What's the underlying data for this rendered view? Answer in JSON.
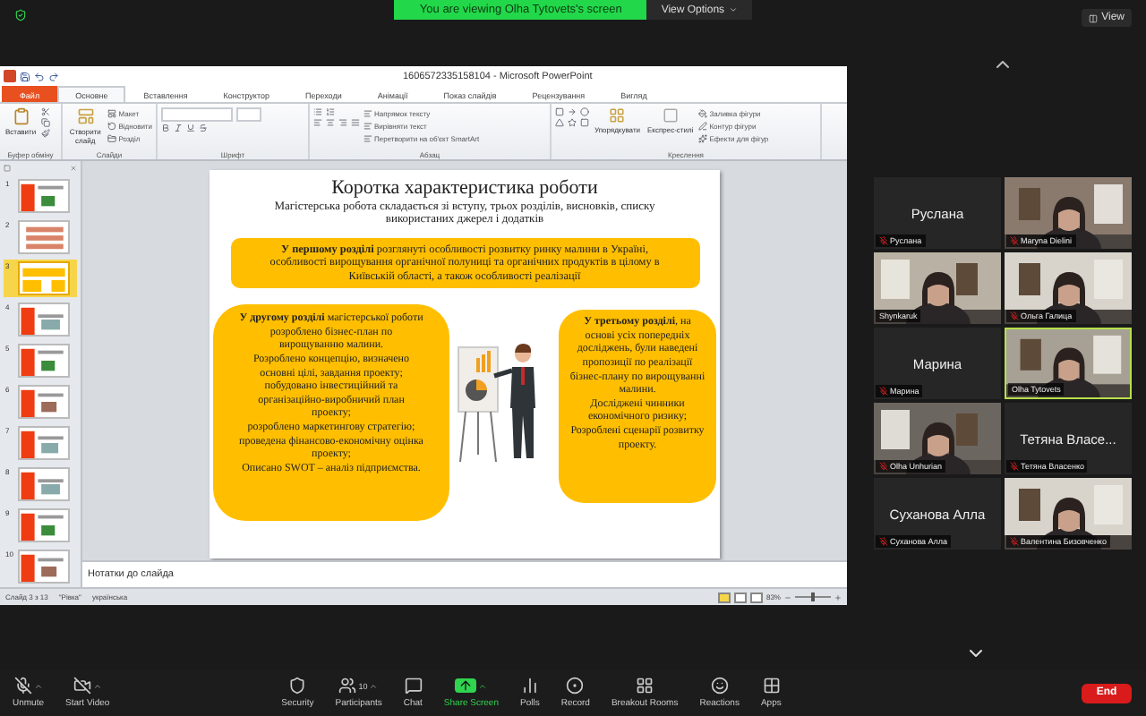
{
  "banner": {
    "text": "You are viewing Olha Tytovets's screen",
    "options": "View Options"
  },
  "view_button": "View",
  "powerpoint": {
    "title": "1606572335158104 - Microsoft PowerPoint",
    "tabs": [
      {
        "label": "Файл",
        "kind": "file",
        "selected": false
      },
      {
        "label": "Основне",
        "kind": "tab",
        "selected": true
      },
      {
        "label": "Вставлення",
        "kind": "tab",
        "selected": false
      },
      {
        "label": "Конструктор",
        "kind": "tab",
        "selected": false
      },
      {
        "label": "Переходи",
        "kind": "tab",
        "selected": false
      },
      {
        "label": "Анімації",
        "kind": "tab",
        "selected": false
      },
      {
        "label": "Показ слайдів",
        "kind": "tab",
        "selected": false
      },
      {
        "label": "Рецензування",
        "kind": "tab",
        "selected": false
      },
      {
        "label": "Вигляд",
        "kind": "tab",
        "selected": false
      }
    ],
    "ribbon": {
      "clipboard": {
        "label": "Буфер обміну",
        "paste": "Вставити"
      },
      "slides": {
        "label": "Слайди",
        "new_slide": "Створити слайд",
        "items": [
          "Макет",
          "Відновити",
          "Розділ"
        ]
      },
      "font": {
        "label": "Шрифт"
      },
      "paragraph": {
        "label": "Абзац",
        "items": [
          "Напрямок тексту",
          "Вирівняти текст",
          "Перетворити на об'єкт SmartArt"
        ]
      },
      "drawing": {
        "label": "Креслення",
        "arrange": "Упорядкувати",
        "styles": "Експрес-стилі",
        "items": [
          "Заливка фігури",
          "Контур фігури",
          "Ефекти для фігур"
        ]
      }
    },
    "thumbnails": [
      {
        "number": "1",
        "selected": false
      },
      {
        "number": "2",
        "selected": false
      },
      {
        "number": "3",
        "selected": true
      },
      {
        "number": "4",
        "selected": false
      },
      {
        "number": "5",
        "selected": false
      },
      {
        "number": "6",
        "selected": false
      },
      {
        "number": "7",
        "selected": false
      },
      {
        "number": "8",
        "selected": false
      },
      {
        "number": "9",
        "selected": false
      },
      {
        "number": "10",
        "selected": false
      }
    ],
    "slide": {
      "title": "Коротка характеристика роботи",
      "subtitle": "Магістерська робота складається зі вступу, трьох розділів, висновків, списку використаних джерел і додатків",
      "box_first": "**У першому розділі** розглянуті особливості розвитку ринку малини в Україні, особливості вирощування органічної полуниці та органічних продуктів в цілому в Київській області, а також особливості реалізації",
      "box_second": [
        "**У другому розділі** магістерської роботи розроблено бізнес-план по вирощуванню малини.",
        "Розроблено концепцію, визначено основні цілі, завдання проекту; побудовано інвестиційний та організаційно-виробничий план проекту;",
        "розроблено маркетингову стратегію; проведена фінансово-економічну оцінка проекту;",
        "Описано SWOT – аналіз підприємства."
      ],
      "box_third": [
        "**У третьому розділі**, на основі усіх попередніх досліджень, були наведені пропозиції по реалізації бізнес-плану по вирощуванні малини.",
        "Досліджені чинники економічного ризику;",
        "Розроблені сценарії розвитку проекту."
      ]
    },
    "notes_placeholder": "Нотатки до слайда",
    "status_bar": {
      "slide": "Слайд 3 з 13",
      "theme": "\"Рівка\"",
      "language": "українська",
      "zoom": "83%",
      "zoom_slider": {
        "level": 0.45
      }
    }
  },
  "participants": [
    {
      "name": "Руслана",
      "kind": "name",
      "big": "Руслана",
      "muted": true,
      "speaking": false
    },
    {
      "name": "Maryna Dielini",
      "kind": "video",
      "muted": true,
      "speaking": false
    },
    {
      "name": "Shynkaruk",
      "kind": "video",
      "muted": false,
      "speaking": false
    },
    {
      "name": "Ольга Галица",
      "kind": "video",
      "muted": true,
      "speaking": false
    },
    {
      "name": "Марина",
      "kind": "name",
      "big": "Марина",
      "muted": true,
      "speaking": false
    },
    {
      "name": "Olha Tytovets",
      "kind": "video",
      "muted": false,
      "speaking": true
    },
    {
      "name": "Olha Unhurian",
      "kind": "video",
      "muted": true,
      "speaking": false
    },
    {
      "name": "Тетяна Власенко",
      "kind": "name",
      "big": "Тетяна Власе...",
      "muted": true,
      "speaking": false
    },
    {
      "name": "Суханова Алла",
      "kind": "name",
      "big": "Суханова Алла",
      "muted": true,
      "speaking": false
    },
    {
      "name": "Валентина Бизовченко",
      "kind": "video",
      "muted": true,
      "speaking": false
    }
  ],
  "toolbar": [
    {
      "label": "Unmute",
      "kind": "mic",
      "caret": true
    },
    {
      "label": "Start Video",
      "kind": "video",
      "caret": true
    },
    {
      "label": "Security",
      "kind": "security",
      "caret": false
    },
    {
      "label": "Participants",
      "kind": "participants",
      "caret": true,
      "count": "10"
    },
    {
      "label": "Chat",
      "kind": "chat",
      "caret": false
    },
    {
      "label": "Share Screen",
      "kind": "share",
      "caret": true
    },
    {
      "label": "Polls",
      "kind": "polls",
      "caret": false
    },
    {
      "label": "Record",
      "kind": "record",
      "caret": false
    },
    {
      "label": "Breakout Rooms",
      "kind": "rooms",
      "caret": false
    },
    {
      "label": "Reactions",
      "kind": "reactions",
      "caret": false
    },
    {
      "label": "Apps",
      "kind": "apps",
      "caret": false
    }
  ],
  "end_button": "End"
}
